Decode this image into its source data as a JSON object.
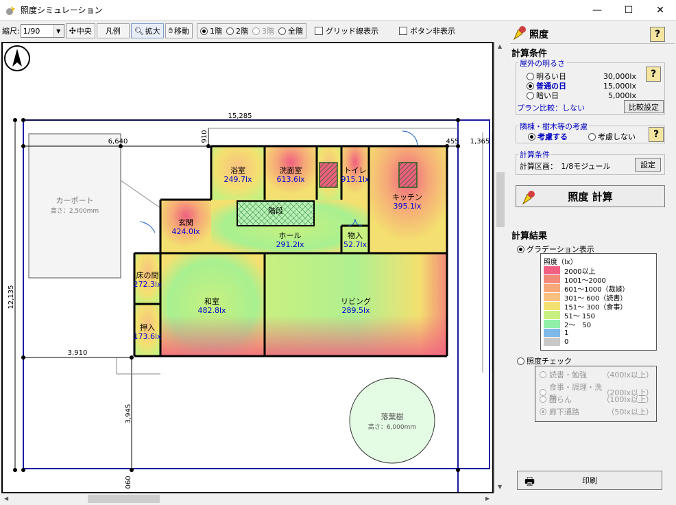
{
  "window": {
    "title": "照度シミュレーション",
    "minimize": "—",
    "maximize": "☐",
    "close": "✕"
  },
  "toolbar": {
    "scale_label": "縮尺:",
    "scale_value": "1/90",
    "center_label": "中央",
    "legend_label": "凡例",
    "zoom_label": "拡大",
    "move_label": "移動",
    "floors": [
      {
        "label": "1階",
        "selected": true,
        "enabled": true
      },
      {
        "label": "2階",
        "selected": false,
        "enabled": true
      },
      {
        "label": "3階",
        "selected": false,
        "enabled": false
      },
      {
        "label": "全階",
        "selected": false,
        "enabled": true
      }
    ],
    "grid_label": "グリッド線表示",
    "hide_buttons_label": "ボタン非表示"
  },
  "plan": {
    "dims": {
      "total_width": "15,285",
      "carport_width": "6,640",
      "d455": "455",
      "d1365": "1,365",
      "d910": "910",
      "height_total": "12,135",
      "d3910": "3,910",
      "d3945": "3,945",
      "d060": "060"
    },
    "carport": {
      "name": "カーポート",
      "height": "高さ：2,500mm"
    },
    "tree": {
      "name": "落葉樹",
      "height": "高さ：6,000mm"
    },
    "rooms": [
      {
        "name": "浴室",
        "lux": "249.7lx"
      },
      {
        "name": "洗面室",
        "lux": "613.6lx"
      },
      {
        "name": "トイレ",
        "lux": "915.1lx"
      },
      {
        "name": "キッチン",
        "lux": "395.1lx"
      },
      {
        "name": "玄関",
        "lux": "424.0lx"
      },
      {
        "name": "階段",
        "lux": ""
      },
      {
        "name": "ホール",
        "lux": "291.2lx"
      },
      {
        "name": "物入",
        "lux": "52.7lx"
      },
      {
        "name": "床の間",
        "lux": "272.3lx"
      },
      {
        "name": "和室",
        "lux": "482.8lx"
      },
      {
        "name": "リビング",
        "lux": "289.5lx"
      },
      {
        "name": "押入",
        "lux": "173.6lx"
      }
    ]
  },
  "panel": {
    "title": "照度",
    "help": "?",
    "conditions_heading": "計算条件",
    "outdoor": {
      "title": "屋外の明るさ",
      "options": [
        {
          "label": "明るい日",
          "value": "30,000lx",
          "selected": false
        },
        {
          "label": "普通の日",
          "value": "15,000lx",
          "selected": true
        },
        {
          "label": "暗い日",
          "value": "5,000lx",
          "selected": false
        }
      ],
      "compare_text": "プラン比較：しない",
      "compare_button": "比較設定"
    },
    "neighbors": {
      "title": "隣棟・樹木等の考慮",
      "option_yes": "考慮する",
      "option_no": "考慮しない"
    },
    "calc_cond": {
      "title": "計算条件",
      "area_text": "計算区画：　1/8モジュール",
      "settings_button": "設定"
    },
    "calc_button": "照度 計算",
    "results_heading": "計算結果",
    "gradation_label": "グラデーション表示",
    "legend_title": "照度（lx）",
    "legend": [
      {
        "label": "2000以上",
        "color": "#f06080"
      },
      {
        "label": "1001～2000",
        "color": "#f28a78"
      },
      {
        "label": "601～1000（裁縫）",
        "color": "#f6a878"
      },
      {
        "label": "301～ 600（読書）",
        "color": "#f8c080"
      },
      {
        "label": "151～ 300（食事）",
        "color": "#f4e070"
      },
      {
        "label": "51～ 150",
        "color": "#c8f080"
      },
      {
        "label": "2～　50",
        "color": "#90f0a8"
      },
      {
        "label": "1",
        "color": "#80b8e8"
      },
      {
        "label": "0",
        "color": "#c8c8c8"
      }
    ],
    "check_label": "照度チェック",
    "checks": [
      {
        "label": "読書・勉強",
        "value": "（400lx以上）",
        "selected": false
      },
      {
        "label": "食事・調理・洗顔",
        "value": "（200lx以上）",
        "selected": false
      },
      {
        "label": "団らん",
        "value": "（100lx以上）",
        "selected": false
      },
      {
        "label": "廊下通路",
        "value": "（50lx以上）",
        "selected": true
      }
    ],
    "print_button": "印刷"
  }
}
